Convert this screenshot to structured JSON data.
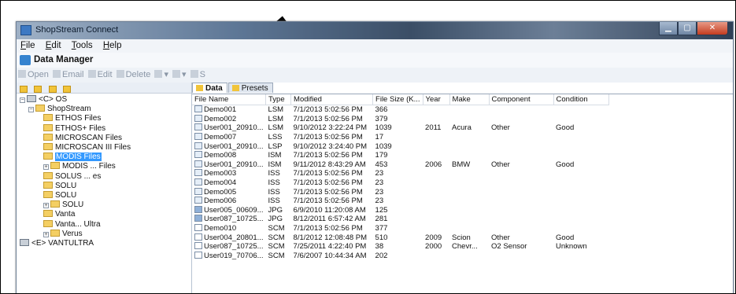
{
  "window": {
    "title": "ShopStream Connect",
    "controls": [
      "minimize",
      "maximize",
      "close"
    ]
  },
  "menu": [
    "File",
    "Edit",
    "Tools",
    "Help"
  ],
  "data_manager_title": "Data Manager",
  "toolbar": {
    "open": "Open",
    "email": "Email",
    "edit": "Edit",
    "delete": "Delete",
    "partial": "S"
  },
  "tree": [
    {
      "label": "<C> OS",
      "depth": 0,
      "expander": "−",
      "kind": "drive"
    },
    {
      "label": "ShopStream",
      "depth": 1,
      "expander": "−",
      "kind": "folder"
    },
    {
      "label": "ETHOS Files",
      "depth": 2,
      "expander": "",
      "kind": "folder"
    },
    {
      "label": "ETHOS+ Files",
      "depth": 2,
      "expander": "",
      "kind": "folder"
    },
    {
      "label": "MICROSCAN Files",
      "depth": 2,
      "expander": "",
      "kind": "folder"
    },
    {
      "label": "MICROSCAN III Files",
      "depth": 2,
      "expander": "",
      "kind": "folder"
    },
    {
      "label": "MODIS Files",
      "depth": 2,
      "expander": "",
      "kind": "folder",
      "selected": true
    },
    {
      "label": "MODIS ... Files",
      "depth": 2,
      "expander": "+",
      "kind": "folder"
    },
    {
      "label": "SOLUS ... es",
      "depth": 2,
      "expander": "",
      "kind": "folder"
    },
    {
      "label": "SOLU",
      "depth": 2,
      "expander": "",
      "kind": "folder"
    },
    {
      "label": "SOLU",
      "depth": 2,
      "expander": "",
      "kind": "folder"
    },
    {
      "label": "SOLU",
      "depth": 2,
      "expander": "+",
      "kind": "folder"
    },
    {
      "label": "Vanta",
      "depth": 2,
      "expander": "",
      "kind": "folder"
    },
    {
      "label": "Vanta... Ultra",
      "depth": 2,
      "expander": "",
      "kind": "folder"
    },
    {
      "label": "Verus",
      "depth": 2,
      "expander": "+",
      "kind": "folder"
    },
    {
      "label": "<E> VANTULTRA",
      "depth": 0,
      "expander": "",
      "kind": "drive"
    }
  ],
  "tabs": [
    {
      "label": "Data",
      "active": true
    },
    {
      "label": "Presets",
      "active": false
    }
  ],
  "columns": [
    "File Name",
    "Type",
    "Modified",
    "File Size (K...",
    "Year",
    "Make",
    "Component",
    "Condition"
  ],
  "rows": [
    [
      "Demo001",
      "LSM",
      "7/1/2013 5:02:56 PM",
      "366",
      "",
      "",
      "",
      ""
    ],
    [
      "Demo002",
      "LSM",
      "7/1/2013 5:02:56 PM",
      "379",
      "",
      "",
      "",
      ""
    ],
    [
      "User001_20910...",
      "LSM",
      "9/10/2012 3:22:24 PM",
      "1039",
      "2011",
      "Acura",
      "Other",
      "Good"
    ],
    [
      "Demo007",
      "LSS",
      "7/1/2013 5:02:56 PM",
      "17",
      "",
      "",
      "",
      ""
    ],
    [
      "User001_20910...",
      "LSP",
      "9/10/2012 3:24:40 PM",
      "1039",
      "",
      "",
      "",
      ""
    ],
    [
      "Demo008",
      "ISM",
      "7/1/2013 5:02:56 PM",
      "179",
      "",
      "",
      "",
      ""
    ],
    [
      "User001_20910...",
      "ISM",
      "9/11/2012 8:43:29 AM",
      "453",
      "2006",
      "BMW",
      "Other",
      "Good"
    ],
    [
      "Demo003",
      "ISS",
      "7/1/2013 5:02:56 PM",
      "23",
      "",
      "",
      "",
      ""
    ],
    [
      "Demo004",
      "ISS",
      "7/1/2013 5:02:56 PM",
      "23",
      "",
      "",
      "",
      ""
    ],
    [
      "Demo005",
      "ISS",
      "7/1/2013 5:02:56 PM",
      "23",
      "",
      "",
      "",
      ""
    ],
    [
      "Demo006",
      "ISS",
      "7/1/2013 5:02:56 PM",
      "23",
      "",
      "",
      "",
      ""
    ],
    [
      "User005_00609...",
      "JPG",
      "6/9/2010 11:20:08 AM",
      "125",
      "",
      "",
      "",
      ""
    ],
    [
      "User087_10725...",
      "JPG",
      "8/12/2011 6:57:42 AM",
      "281",
      "",
      "",
      "",
      ""
    ],
    [
      "Demo010",
      "SCM",
      "7/1/2013 5:02:56 PM",
      "377",
      "",
      "",
      "",
      ""
    ],
    [
      "User004_20801...",
      "SCM",
      "8/1/2012 12:08:48 PM",
      "510",
      "2009",
      "Scion",
      "Other",
      "Good"
    ],
    [
      "User087_10725...",
      "SCM",
      "7/25/2011 4:22:40 PM",
      "38",
      "2000",
      "Chevr...",
      "O2 Sensor",
      "Unknown"
    ],
    [
      "User019_70706...",
      "SCM",
      "7/6/2007 10:44:34 AM",
      "202",
      "",
      "",
      "",
      ""
    ]
  ],
  "colors": {
    "selection": "#3399ff",
    "folder": "#f4cf63",
    "arrow": "#000000"
  }
}
